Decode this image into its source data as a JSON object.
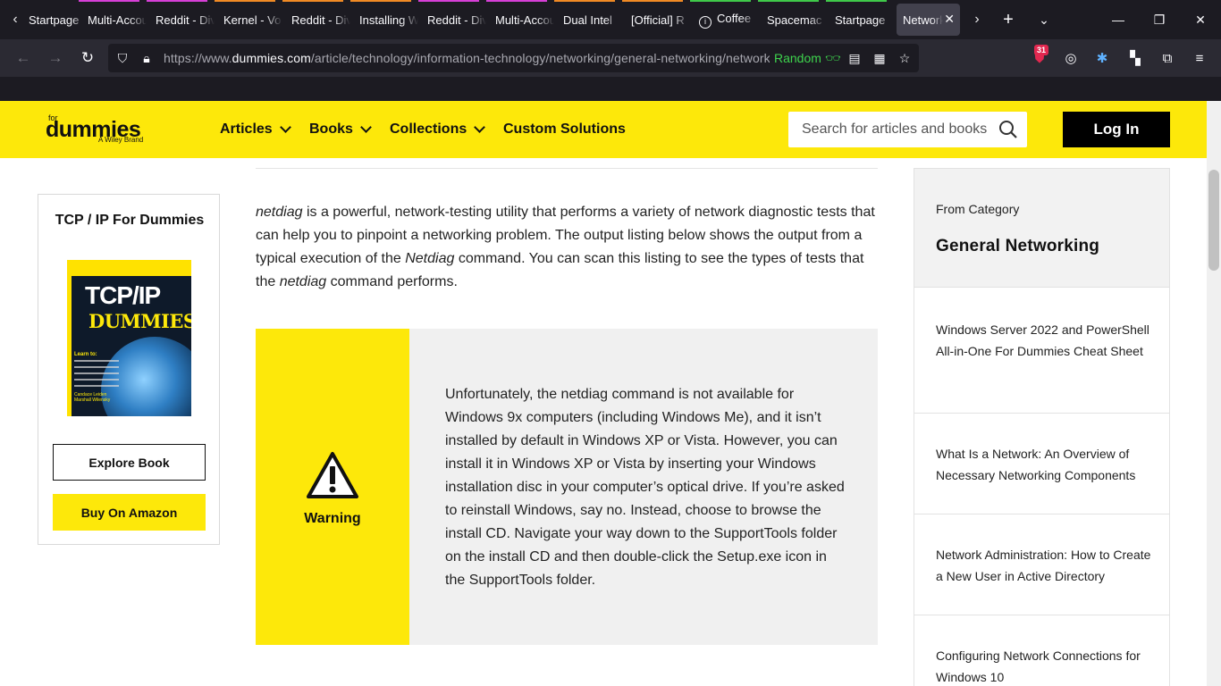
{
  "browser": {
    "tabs": [
      {
        "label": "Startpage",
        "stripe": ""
      },
      {
        "label": "Multi-Account",
        "stripe": "#d63fd6"
      },
      {
        "label": "Reddit - Dive",
        "stripe": "#d63fd6"
      },
      {
        "label": "Kernel - Vo",
        "stripe": "#f08a24"
      },
      {
        "label": "Reddit - Dive",
        "stripe": "#f08a24"
      },
      {
        "label": "Installing W",
        "stripe": "#f08a24"
      },
      {
        "label": "Reddit - Dive",
        "stripe": "#d63fd6"
      },
      {
        "label": "Multi-Account",
        "stripe": "#d63fd6"
      },
      {
        "label": "Dual Intel",
        "stripe": "#f08a24"
      },
      {
        "label": "[Official] R",
        "stripe": "#f08a24"
      },
      {
        "label": "Coffee",
        "stripe": "#3fc94a"
      },
      {
        "label": "Spacemac",
        "stripe": "#3fc94a"
      },
      {
        "label": "Startpage",
        "stripe": "#3fc94a"
      },
      {
        "label": "Network",
        "stripe": ""
      }
    ],
    "url_scheme": "https://www.",
    "url_host": "dummies.com",
    "url_path": "/article/technology/information-technology/networking/general-networking/network-basics-netdiag-",
    "random_label": "Random",
    "ublock_badge": "31"
  },
  "site": {
    "logo_for": "for",
    "logo_word": "dummies",
    "logo_brand": "A Wiley Brand",
    "menu": [
      "Articles",
      "Books",
      "Collections",
      "Custom Solutions"
    ],
    "search_placeholder": "Search for articles and books",
    "login_label": "Log In"
  },
  "book": {
    "title": "TCP / IP For Dummies",
    "cover_title": "TCP/IP",
    "cover_sub": "DUMMIES",
    "cover_learn": "Learn to:",
    "cover_authors": "Candace Leiden\nMarshall Wilensky",
    "explore_label": "Explore Book",
    "amazon_label": "Buy On Amazon"
  },
  "article": {
    "intro_1": "netdiag",
    "intro_2": " is a powerful, network-testing utility that performs a variety of network diagnostic tests that can help you to pinpoint a networking problem. The output listing below shows the output from a typical execution of the ",
    "intro_3": "Netdiag",
    "intro_4": " command. You can scan this listing to see the types of tests that the ",
    "intro_5": "netdiag",
    "intro_6": " command performs.",
    "warning_label": "Warning",
    "warning_text": "Unfortunately, the netdiag command is not available for Windows 9x computers (including Windows Me), and it isn’t installed by default in Windows XP or Vista. However, you can install it in Windows XP or Vista by inserting your Windows installation disc in your computer’s optical drive. If you’re asked to reinstall Windows, say no. Instead, choose to browse the install CD. Navigate your way down to the SupportTools folder on the install CD and then double-click the Setup.exe icon in the SupportTools folder."
  },
  "sidebar": {
    "label": "From Category",
    "title": "General Networking",
    "items": [
      "Windows Server 2022 and PowerShell All-in-One For Dummies Cheat Sheet",
      "What Is a Network: An Overview of Necessary Networking Components",
      "Network Administration: How to Create a New User in Active Directory",
      "Configuring Network Connections for Windows 10"
    ]
  },
  "colors": {
    "brand_yellow": "#fde80a",
    "chrome_dark": "#1c1b22",
    "toolbar": "#2b2a33"
  }
}
